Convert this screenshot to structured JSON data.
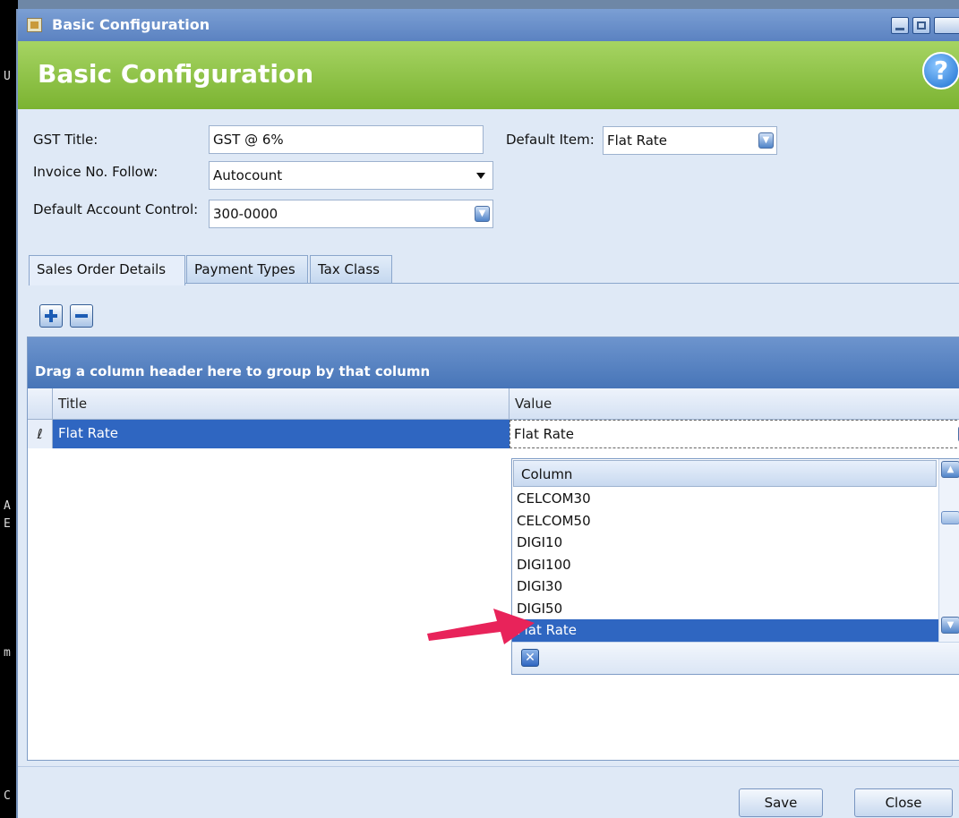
{
  "window": {
    "title": "Basic Configuration"
  },
  "header": {
    "title": "Basic Configuration",
    "help_icon": "?"
  },
  "form": {
    "gst_title_label": "GST Title:",
    "gst_title_value": "GST @ 6%",
    "invoice_label": "Invoice No. Follow:",
    "invoice_value": "Autocount",
    "account_label": "Default Account Control:",
    "account_value": "300-0000",
    "default_item_label": "Default Item:",
    "default_item_value": "Flat Rate"
  },
  "tabs": [
    "Sales Order Details",
    "Payment Types",
    "Tax Class"
  ],
  "grid": {
    "group_panel_text": "Drag a column header here to group by that column",
    "columns": [
      "Title",
      "Value"
    ],
    "row": {
      "indicator": "ℓ",
      "title": "Flat Rate",
      "value": "Flat Rate"
    }
  },
  "popup": {
    "header": "Column",
    "items": [
      "CELCOM30",
      "CELCOM50",
      "DIGI10",
      "DIGI100",
      "DIGI30",
      "DIGI50",
      "Flat Rate"
    ],
    "selected": "Flat Rate"
  },
  "buttons": {
    "save": "Save",
    "close": "Close"
  },
  "colors": {
    "header_green": "#7bb331",
    "selection_blue": "#2f66c1",
    "annotation_arrow": "#e8235a"
  },
  "background_fragments": [
    "U",
    "A",
    "E",
    "m",
    "C"
  ]
}
